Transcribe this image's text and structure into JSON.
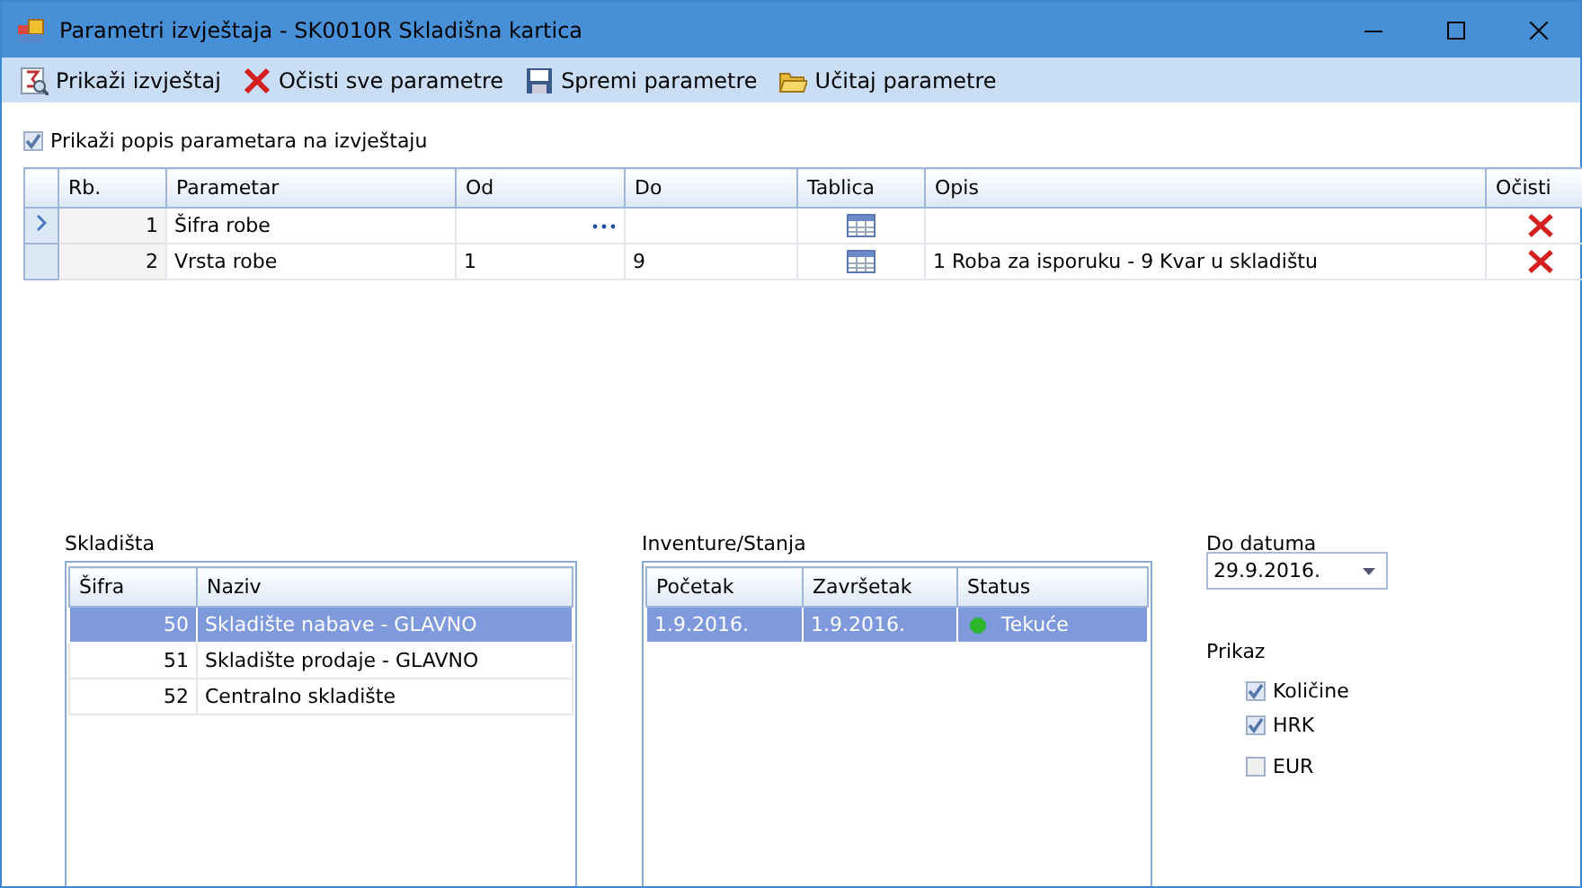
{
  "window": {
    "title": "Parametri izvještaja - SK0010R Skladišna kartica"
  },
  "toolbar": [
    {
      "kind": "report",
      "label": "Prikaži izvještaj"
    },
    {
      "kind": "clear",
      "label": "Očisti sve parametre"
    },
    {
      "kind": "save",
      "label": "Spremi parametre"
    },
    {
      "kind": "load",
      "label": "Učitaj parametre"
    }
  ],
  "show_parameter_list": {
    "label": "Prikaži popis parametara na izvještaju",
    "checked": true
  },
  "parameters": {
    "columns": [
      "Rb.",
      "Parametar",
      "Od",
      "Do",
      "Tablica",
      "Opis",
      "Očisti"
    ],
    "rows": [
      {
        "current": true,
        "editing": true,
        "number": "1",
        "parameter": "Šifra robe"
      },
      {
        "current": false,
        "editing": false,
        "number": "2",
        "parameter": "Vrsta robe",
        "from": "1",
        "to": "9",
        "description": "1 Roba za isporuku - 9 Kvar u skladištu"
      }
    ]
  },
  "warehouses": {
    "label": "Skladišta",
    "columns": [
      "Šifra",
      "Naziv"
    ],
    "rows": [
      {
        "code": "50",
        "name": "Skladište nabave - GLAVNO",
        "selected": true
      },
      {
        "code": "51",
        "name": "Skladište prodaje - GLAVNO",
        "selected": false
      },
      {
        "code": "52",
        "name": "Centralno skladište",
        "selected": false
      }
    ]
  },
  "inventories": {
    "label": "Inventure/Stanja",
    "columns": [
      "Početak",
      "Završetak",
      "Status"
    ],
    "rows": [
      {
        "start": "1.9.2016.",
        "end": "1.9.2016.",
        "status": "Tekuće",
        "color": "#2bb52b",
        "selected": true
      }
    ]
  },
  "date": {
    "label": "Do datuma",
    "value": "29.9.2016."
  },
  "display": {
    "label": "Prikaz",
    "options": [
      {
        "label": "Količine",
        "checked": true
      },
      {
        "label": "HRK",
        "checked": true
      },
      {
        "label": "EUR",
        "checked": false
      }
    ]
  }
}
